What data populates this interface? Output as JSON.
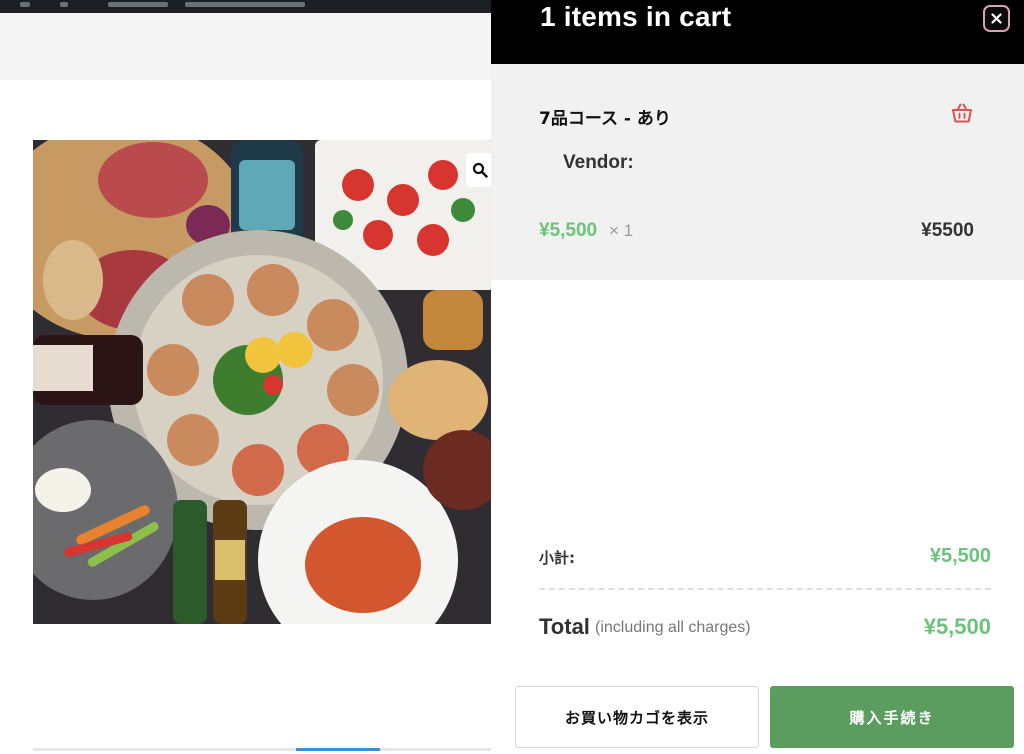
{
  "cart": {
    "title": "1  items in cart",
    "close_label": "×",
    "item": {
      "name": "7品コース - あり",
      "vendor_label": "Vendor:",
      "unit_price": "¥5,500",
      "quantity_text": "× 1",
      "line_total": "¥5500",
      "remove_icon": "basket-icon"
    },
    "summary": {
      "subtotal_label": "小計:",
      "subtotal_value": "¥5,500",
      "total_label": "Total",
      "total_note": "(including all charges)",
      "total_value": "¥5,500"
    },
    "buttons": {
      "view_cart": "お買い物カゴを表示",
      "checkout": "購入手続き"
    }
  },
  "colors": {
    "header_bg": "#000000",
    "price_green": "#6dc27c",
    "checkout_green": "#5a9d5f",
    "remove_red": "#d9534f",
    "item_bg": "#f1f1f1"
  },
  "background_page": {
    "zoom_icon": "magnifier-icon",
    "photo_icon": "food-platter-photo"
  }
}
